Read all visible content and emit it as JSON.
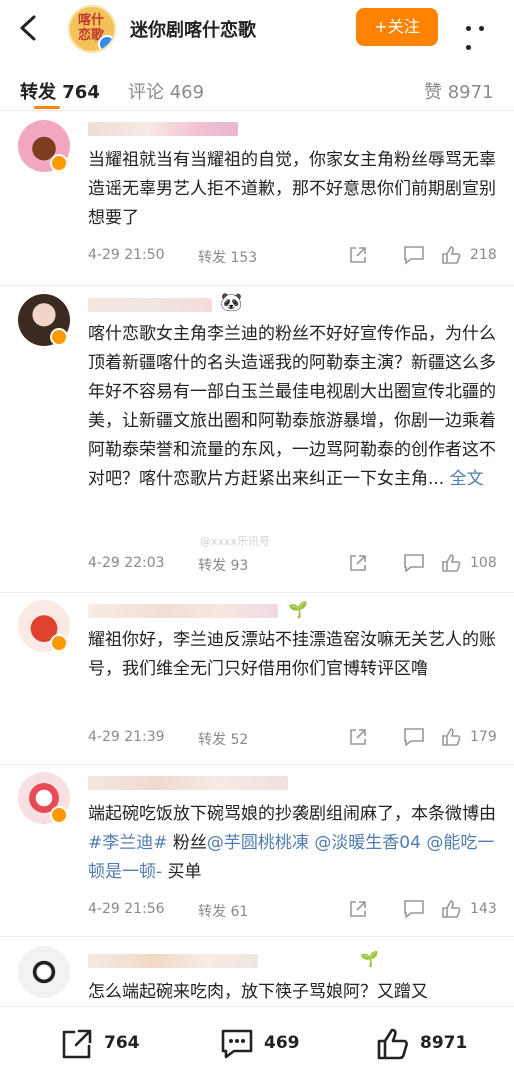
{
  "header": {
    "account_name": "迷你剧喀什恋歌",
    "logo_text": "喀什恋歌",
    "follow_label": "+关注"
  },
  "tabs": [
    {
      "label": "转发 764",
      "active": true
    },
    {
      "label": "评论 469"
    },
    {
      "label": "赞 8971"
    }
  ],
  "comments": [
    {
      "text": "当耀祖就当有当耀祖的自觉，你家女主角粉丝辱骂无辜造谣无辜男艺人拒不道歉，那不好意思你们前期剧宣别想要了",
      "time": "4-29 21:50",
      "reposts": "转发 153",
      "likes": "218"
    },
    {
      "text": "喀什恋歌女主角李兰迪的粉丝不好好宣传作品，为什么顶着新疆喀什的名头造谣我的阿勒泰主演？新疆这么多年好不容易有一部白玉兰最佳电视剧大出圈宣传北疆的美，让新疆文旅出圈和阿勒泰旅游暴增，你剧一边乘着阿勒泰荣誉和流量的东风，一边骂阿勒泰的创作者这不对吧？喀什恋歌片方赶紧出来纠正一下女主角...",
      "full_text_link": "全文",
      "time": "4-29 22:03",
      "reposts": "转发 93",
      "likes": "108",
      "badge_emoji": "🐼"
    },
    {
      "text": "耀祖你好，李兰迪反漂站不挂漂造窑汝嘛无关艺人的账号，我们维全无门只好借用你们官博转评区噜",
      "time": "4-29 21:39",
      "reposts": "转发 52",
      "likes": "179",
      "badge_emoji": "🌱"
    },
    {
      "text_a": "端起碗吃饭放下碗骂娘的抄袭剧组闹麻了，本条微博由",
      "tag": "#李兰迪#",
      "text_b": " 粉丝",
      "mention1": "@芋圆桃桃凍",
      "text_c": " ",
      "mention2": "@淡暖生香04",
      "text_d": " ",
      "mention3": "@能吃一顿是一顿-",
      "text_e": " 买单",
      "time": "4-29 21:56",
      "reposts": "转发 61",
      "likes": "143"
    },
    {
      "text": "怎么端起碗来吃肉，放下筷子骂娘阿？又蹭又",
      "badge_emoji": "🌱"
    }
  ],
  "watermark": "@xxxx乐讯号",
  "bottom": {
    "reposts": "764",
    "comments": "469",
    "likes": "8971"
  },
  "colors": {
    "accent": "#ff8200",
    "link": "#507daf",
    "muted": "#8a8a8a"
  }
}
